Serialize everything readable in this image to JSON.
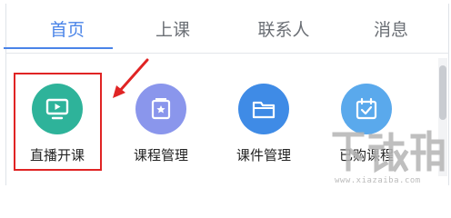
{
  "tabs": [
    {
      "label": "首页",
      "active": true
    },
    {
      "label": "上课",
      "active": false
    },
    {
      "label": "联系人",
      "active": false
    },
    {
      "label": "消息",
      "active": false
    }
  ],
  "apps": [
    {
      "label": "直播开课",
      "icon": "monitor-play-icon",
      "color": "#2eb39a"
    },
    {
      "label": "课程管理",
      "icon": "course-folder-icon",
      "color": "#8a96ec"
    },
    {
      "label": "课件管理",
      "icon": "folder-icon",
      "color": "#3f8be6"
    },
    {
      "label": "已购课程",
      "icon": "calendar-check-icon",
      "color": "#5aa9ec"
    }
  ],
  "colors": {
    "accent": "#4a84e8",
    "highlight": "#e02424"
  },
  "watermark": {
    "site": "www.xiazaiba.com"
  }
}
